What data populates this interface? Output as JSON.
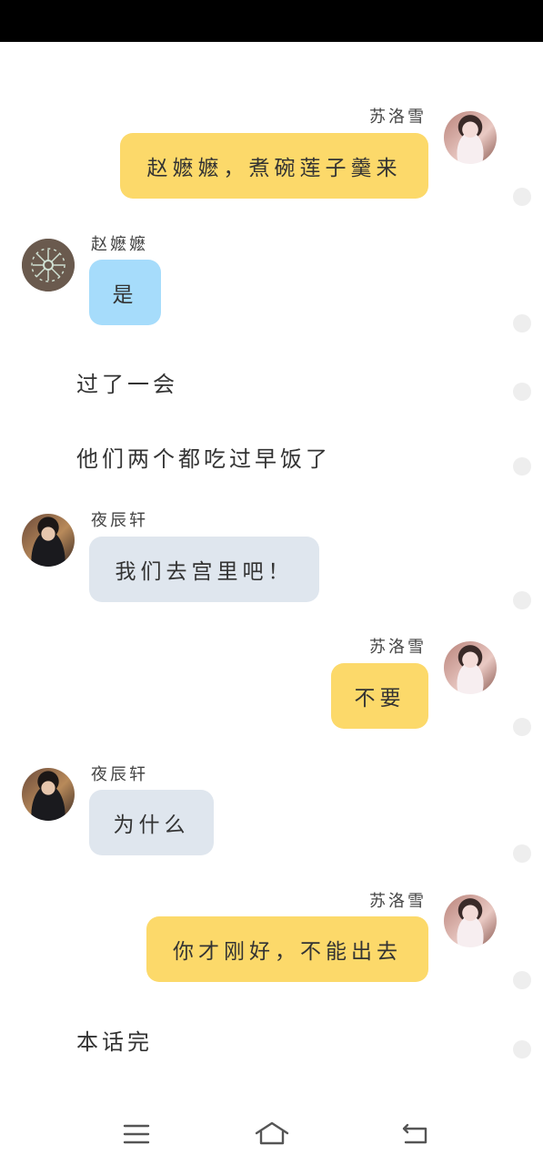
{
  "status_bar": {},
  "messages": [
    {
      "speaker": "苏洛雪",
      "text": "赵嬷嬷，煮碗莲子羹来"
    },
    {
      "speaker": "赵嬷嬷",
      "text": "是"
    },
    {
      "narration": "过了一会"
    },
    {
      "narration": "他们两个都吃过早饭了"
    },
    {
      "speaker": "夜辰轩",
      "text": "我们去宫里吧！"
    },
    {
      "speaker": "苏洛雪",
      "text": "不要"
    },
    {
      "speaker": "夜辰轩",
      "text": "为什么"
    },
    {
      "speaker": "苏洛雪",
      "text": "你才刚好，不能出去"
    },
    {
      "narration": "本话完"
    }
  ],
  "bubble_colors": {
    "right": "#fcd96a",
    "zhao": "#a6dcfb",
    "ye": "#dfe6ee"
  },
  "nav_bar": {
    "icons": [
      "menu-icon",
      "home-icon",
      "back-icon"
    ]
  }
}
